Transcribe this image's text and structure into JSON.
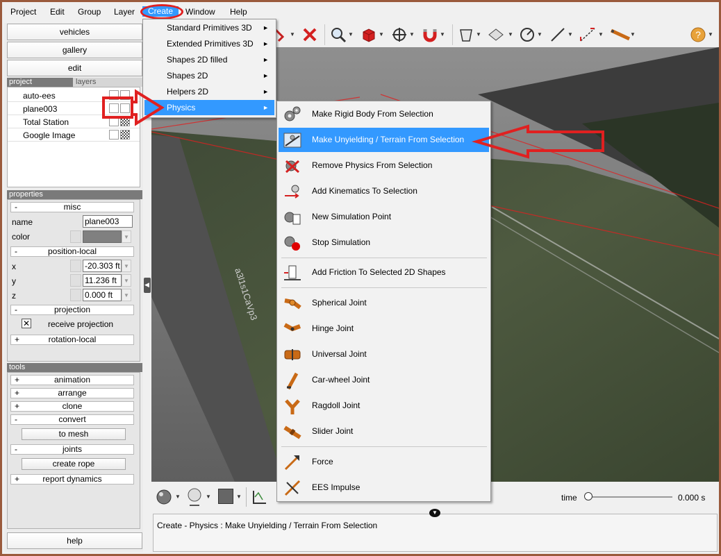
{
  "menubar": {
    "items": [
      "Project",
      "Edit",
      "Group",
      "Layer",
      "Create",
      "Window",
      "Help"
    ],
    "active": "Create"
  },
  "left_panel": {
    "buttons": [
      "vehicles",
      "gallery",
      "edit"
    ],
    "tabs": [
      "project",
      "layers"
    ],
    "layers": [
      "auto-ees",
      "plane003",
      "Total Station",
      "Google Image"
    ],
    "properties": {
      "header": "properties",
      "misc": {
        "sign": "-",
        "label": "misc"
      },
      "name_label": "name",
      "name_value": "plane003",
      "color_label": "color",
      "color_value": "#808080",
      "position": {
        "sign": "-",
        "label": "position-local"
      },
      "x_label": "x",
      "x_value": "-20.303 ft",
      "y_label": "y",
      "y_value": "11.236 ft",
      "z_label": "z",
      "z_value": "0.000 ft",
      "projection": {
        "sign": "-",
        "label": "projection"
      },
      "receive_projection": "receive projection",
      "receive_projection_checked": true,
      "rotation": {
        "sign": "+",
        "label": "rotation-local"
      }
    },
    "tools": {
      "header": "tools",
      "animation": {
        "sign": "+",
        "label": "animation"
      },
      "arrange": {
        "sign": "+",
        "label": "arrange"
      },
      "clone": {
        "sign": "+",
        "label": "clone"
      },
      "convert": {
        "sign": "-",
        "label": "convert"
      },
      "to_mesh": "to mesh",
      "joints": {
        "sign": "-",
        "label": "joints"
      },
      "create_rope": "create rope",
      "report_dynamics": {
        "sign": "+",
        "label": "report dynamics"
      }
    },
    "help": "help"
  },
  "create_menu": {
    "items": [
      "Standard Primitives 3D",
      "Extended Primitives 3D",
      "Shapes 2D filled",
      "Shapes 2D",
      "Helpers 2D",
      "Physics"
    ],
    "highlighted": "Physics"
  },
  "physics_menu": {
    "items": [
      {
        "label": "Make Rigid Body From Selection",
        "icon": "gears-icon"
      },
      {
        "label": "Make Unyielding / Terrain From Selection",
        "icon": "terrain-icon"
      },
      {
        "label": "Remove Physics From Selection",
        "icon": "remove-physics-icon"
      },
      {
        "label": "Add Kinematics To Selection",
        "icon": "kinematics-icon"
      },
      {
        "label": "New Simulation Point",
        "icon": "simulation-point-icon"
      },
      {
        "label": "Stop Simulation",
        "icon": "stop-simulation-icon"
      },
      {
        "label": "Add Friction To Selected 2D Shapes",
        "icon": "friction-icon"
      },
      {
        "label": "Spherical Joint",
        "icon": "spherical-joint-icon"
      },
      {
        "label": "Hinge Joint",
        "icon": "hinge-joint-icon"
      },
      {
        "label": "Universal Joint",
        "icon": "universal-joint-icon"
      },
      {
        "label": "Car-wheel Joint",
        "icon": "car-wheel-joint-icon"
      },
      {
        "label": "Ragdoll Joint",
        "icon": "ragdoll-joint-icon"
      },
      {
        "label": "Slider Joint",
        "icon": "slider-joint-icon"
      },
      {
        "label": "Force",
        "icon": "force-icon"
      },
      {
        "label": "EES Impulse",
        "icon": "impulse-icon"
      }
    ],
    "highlighted": "Make Unyielding / Terrain From Selection"
  },
  "viewport": {
    "ground_text": "a3l1s1CaVp3"
  },
  "bottom": {
    "time_label": "time",
    "time_value": "0.000 s",
    "time_fraction": 0
  },
  "status": {
    "text": "Create - Physics : Make Unyielding / Terrain From Selection"
  },
  "colors": {
    "accent": "#3399ff",
    "annotation": "#e02020",
    "frame": "#9a5a3c"
  }
}
